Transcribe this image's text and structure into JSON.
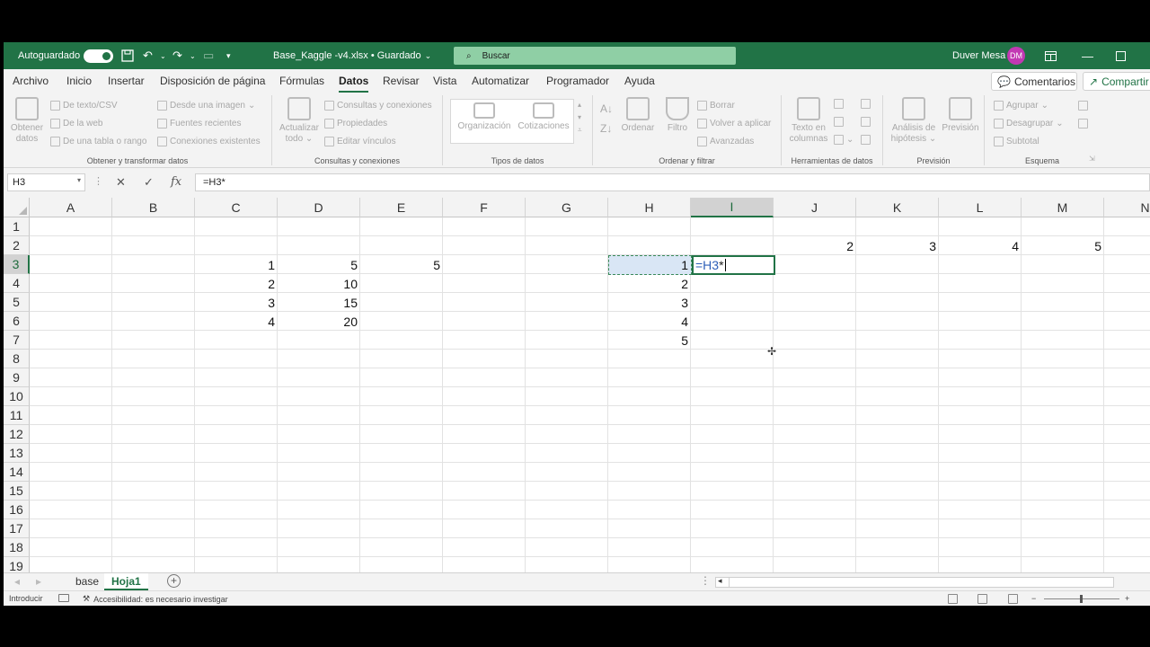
{
  "titlebar": {
    "autosave_label": "Autoguardado",
    "filename": "Base_Kaggle -v4.xlsx • Guardado",
    "search_placeholder": "Buscar",
    "user_name": "Duver Mesa",
    "user_initials": "DM"
  },
  "menu": {
    "items": [
      "Archivo",
      "Inicio",
      "Insertar",
      "Disposición de página",
      "Fórmulas",
      "Datos",
      "Revisar",
      "Vista",
      "Automatizar",
      "Programador",
      "Ayuda"
    ],
    "active": "Datos",
    "comments_label": "Comentarios",
    "share_label": "Compartir"
  },
  "ribbon": {
    "get_data": {
      "label": "Obtener y transformar datos",
      "big_button_line1": "Obtener",
      "big_button_line2": "datos",
      "from_text": "De texto/CSV",
      "from_web": "De la web",
      "from_table": "De una tabla o rango",
      "from_image": "Desde una imagen",
      "recent_sources": "Fuentes recientes",
      "existing_connections": "Conexiones existentes"
    },
    "queries": {
      "label": "Consultas y conexiones",
      "refresh_line1": "Actualizar",
      "refresh_line2": "todo",
      "queries_connections": "Consultas y conexiones",
      "properties": "Propiedades",
      "edit_links": "Editar vínculos"
    },
    "data_types": {
      "label": "Tipos de datos",
      "organization": "Organización",
      "quotes": "Cotizaciones"
    },
    "sort_filter": {
      "label": "Ordenar y filtrar",
      "sort": "Ordenar",
      "filter": "Filtro",
      "clear": "Borrar",
      "reapply": "Volver a aplicar",
      "advanced": "Avanzadas"
    },
    "data_tools": {
      "label": "Herramientas de datos",
      "text_to_columns_line1": "Texto en",
      "text_to_columns_line2": "columnas"
    },
    "forecast": {
      "label": "Previsión",
      "what_if_line1": "Análisis de",
      "what_if_line2": "hipótesis",
      "forecast_sheet": "Previsión"
    },
    "outline": {
      "label": "Esquema",
      "group": "Agrupar",
      "ungroup": "Desagrupar",
      "subtotal": "Subtotal"
    }
  },
  "formula_bar": {
    "name_box": "H3",
    "formula": "=H3*"
  },
  "grid": {
    "columns": [
      "A",
      "B",
      "C",
      "D",
      "E",
      "F",
      "G",
      "H",
      "I",
      "J",
      "K",
      "L",
      "M",
      "N"
    ],
    "rows": [
      "1",
      "2",
      "3",
      "4",
      "5",
      "6",
      "7",
      "8",
      "9",
      "10",
      "11",
      "12",
      "13",
      "14",
      "15",
      "16",
      "17",
      "18",
      "19"
    ],
    "selected_column": "I",
    "selected_row": "3",
    "cells": [
      {
        "ref": "J2",
        "value": "2"
      },
      {
        "ref": "K2",
        "value": "3"
      },
      {
        "ref": "L2",
        "value": "4"
      },
      {
        "ref": "M2",
        "value": "5"
      },
      {
        "ref": "C3",
        "value": "1"
      },
      {
        "ref": "D3",
        "value": "5"
      },
      {
        "ref": "E3",
        "value": "5"
      },
      {
        "ref": "H3",
        "value": "1"
      },
      {
        "ref": "C4",
        "value": "2"
      },
      {
        "ref": "D4",
        "value": "10"
      },
      {
        "ref": "H4",
        "value": "2"
      },
      {
        "ref": "C5",
        "value": "3"
      },
      {
        "ref": "D5",
        "value": "15"
      },
      {
        "ref": "H5",
        "value": "3"
      },
      {
        "ref": "C6",
        "value": "4"
      },
      {
        "ref": "D6",
        "value": "20"
      },
      {
        "ref": "H6",
        "value": "4"
      },
      {
        "ref": "H7",
        "value": "5"
      }
    ],
    "editing": {
      "ref_text": "=H3",
      "op_text": "*"
    }
  },
  "sheets": {
    "tabs": [
      "base",
      "Hoja1"
    ],
    "active": "Hoja1"
  },
  "status": {
    "mode": "Introducir",
    "accessibility": "Accesibilidad: es necesario investigar"
  }
}
